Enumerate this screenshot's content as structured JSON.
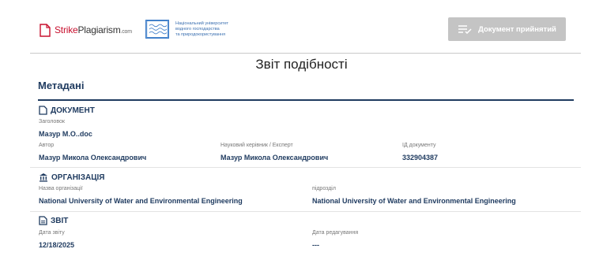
{
  "header": {
    "brand_part1": "Strike",
    "brand_part2": "Plagiarism",
    "brand_part3": ".com",
    "university_lines": [
      "Національний університет",
      "водного господарства",
      "та природокористування"
    ],
    "accept_button_label": "Документ прийнятий"
  },
  "report_title": "Звіт подібності",
  "metadata_title": "Метадані",
  "document": {
    "section_label": "ДОКУМЕНТ",
    "title_label": "Заголовок",
    "title_value": "Мазур М.О..doc",
    "author_label": "Автор",
    "author_value": "Мазур Микола Олександрович",
    "supervisor_label": "Науковий керівник / Експерт",
    "supervisor_value": "Мазур Микола Олександрович",
    "doc_id_label": "ІД документу",
    "doc_id_value": "332904387"
  },
  "organization": {
    "section_label": "ОРГАНІЗАЦІЯ",
    "org_name_label": "Назва організації",
    "org_name_value": "National University of Water and Environmental Engineering",
    "subdivision_label": "підрозділ",
    "subdivision_value": "National University of Water and Environmental Engineering"
  },
  "report": {
    "section_label": "ЗВІТ",
    "report_date_label": "Дата звіту",
    "report_date_value": "12/18/2025",
    "edit_date_label": "Дата редагування",
    "edit_date_value": "---"
  },
  "colors": {
    "navy": "#1e3a5f",
    "brand_red": "#c8102e",
    "button_gray": "#c4c4c4"
  }
}
